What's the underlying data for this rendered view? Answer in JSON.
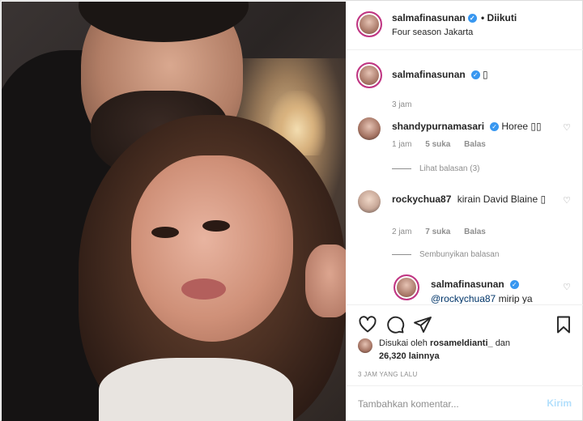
{
  "post": {
    "author": "salmafinasunan",
    "separator": "•",
    "follow_status": "Diikuti",
    "location": "Four season Jakarta",
    "verified_icon": "check-badge-icon"
  },
  "caption": {
    "username": "salmafinasunan",
    "text": "▯",
    "time": "3 jam"
  },
  "comments": [
    {
      "username": "shandypurnamasari",
      "verified": true,
      "text": "Horee ▯▯",
      "time": "1 jam",
      "likes": "5 suka",
      "reply_label": "Balas",
      "thread_label": "Lihat balasan (3)"
    },
    {
      "username": "rockychua87",
      "verified": false,
      "text": "kirain David Blaine ▯",
      "time": "2 jam",
      "likes": "7 suka",
      "reply_label": "Balas",
      "thread_label": "Sembunyikan balasan"
    }
  ],
  "reply": {
    "username": "salmafinasunan",
    "mention": "@rockychua87",
    "text": "mirip ya"
  },
  "likes": {
    "prefix": "Disukai oleh",
    "user": "rosameldianti_",
    "joiner": "dan",
    "count": "26,320 lainnya"
  },
  "timestamp": "3 JAM YANG LALU",
  "composer": {
    "placeholder": "Tambahkan komentar...",
    "post_label": "Kirim"
  }
}
